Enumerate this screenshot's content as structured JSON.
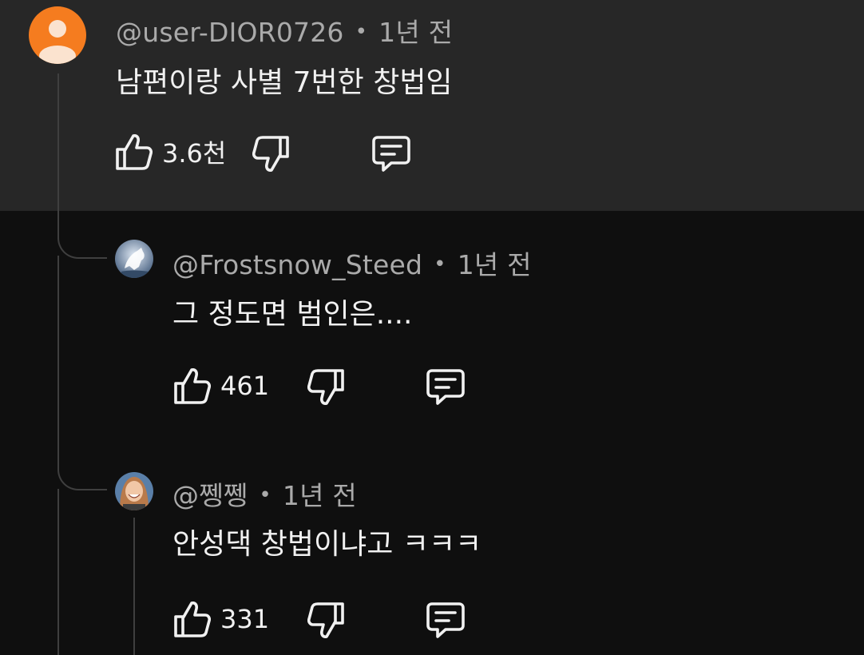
{
  "comments": [
    {
      "author": "@user-DIOR0726",
      "separator": "•",
      "time": "1년 전",
      "text": "남편이랑 사별 7번한 창법임",
      "likes": "3.6천",
      "avatar_color": "#f57c1f"
    },
    {
      "author": "@Frostsnow_Steed",
      "separator": "•",
      "time": "1년 전",
      "text": "그 정도면 범인은....",
      "likes": "461",
      "avatar_color": "#8fa6c4"
    },
    {
      "author": "@쩽쩽",
      "separator": "•",
      "time": "1년 전",
      "text": "안성댁 창법이냐고 ㅋㅋㅋ",
      "likes": "331",
      "avatar_color": "#6b4a3a"
    }
  ],
  "colors": {
    "background": "#0f0f0f",
    "highlight": "#272727",
    "meta_text": "#aaaaaa",
    "primary_text": "#f1f1f1",
    "thread_line": "#3f3f3f"
  },
  "icons": {
    "like": "thumbs-up-icon",
    "dislike": "thumbs-down-icon",
    "reply": "comment-icon",
    "avatar_default": "person-icon"
  }
}
